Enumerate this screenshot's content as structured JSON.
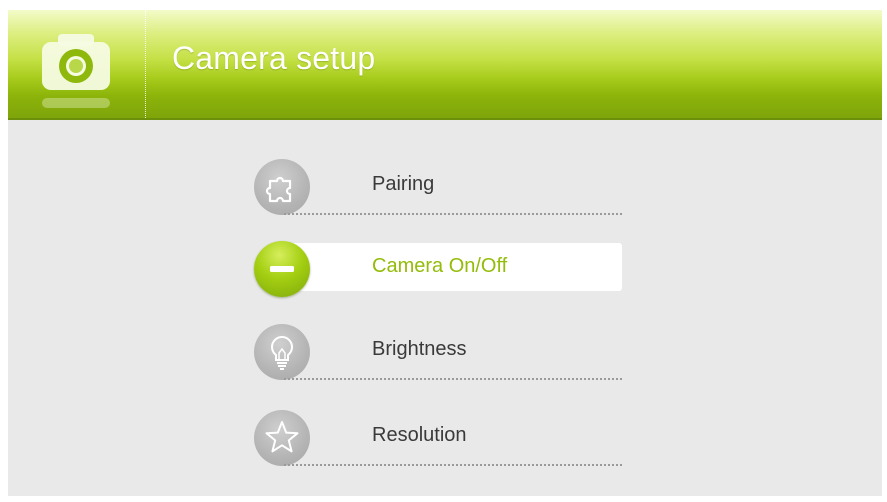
{
  "header": {
    "title": "Camera setup",
    "icon": "camera-icon"
  },
  "menu": {
    "items": [
      {
        "label": "Pairing",
        "icon": "puzzle-icon",
        "selected": false
      },
      {
        "label": "Camera On/Off",
        "icon": "minus-icon",
        "selected": true
      },
      {
        "label": "Brightness",
        "icon": "lightbulb-icon",
        "selected": false
      },
      {
        "label": "Resolution",
        "icon": "star-icon",
        "selected": false
      }
    ]
  },
  "colors": {
    "accent": "#94bc0a",
    "header_green": "#a8cc1c",
    "background": "#e9e9e9",
    "icon_gray": "#b4b4b4"
  }
}
